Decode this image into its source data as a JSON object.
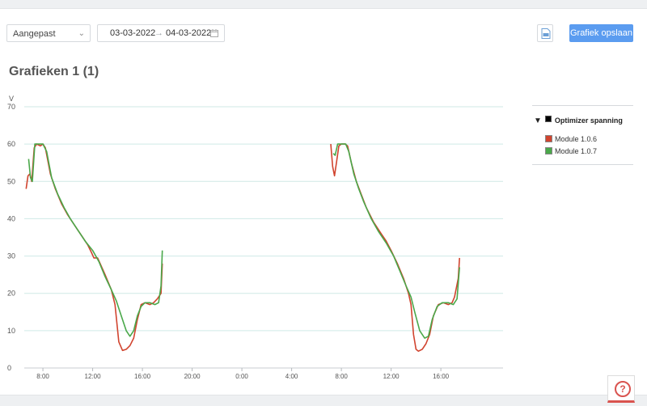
{
  "toolbar": {
    "period_select": "Aangepast",
    "date_from": "03-03-2022",
    "date_arrow": "→",
    "date_to": "04-03-2022",
    "save_label": "Grafiek opslaan"
  },
  "page_title": "Grafieken 1 (1)",
  "legend": {
    "group": "Optimizer spanning",
    "items": [
      {
        "label": "Module 1.0.6",
        "color": "#d1442f"
      },
      {
        "label": "Module 1.0.7",
        "color": "#4aa84a"
      }
    ]
  },
  "help_label": "?",
  "chart_data": {
    "type": "line",
    "ylabel": "V",
    "ylim": [
      0,
      70
    ],
    "yticks": [
      0,
      10,
      20,
      30,
      40,
      50,
      60,
      70
    ],
    "xlim": [
      6.5,
      45.0
    ],
    "xticks": [
      {
        "t": 8,
        "label": "8:00"
      },
      {
        "t": 12,
        "label": "12:00"
      },
      {
        "t": 16,
        "label": "16:00"
      },
      {
        "t": 20,
        "label": "20:00"
      },
      {
        "t": 24,
        "label": "0:00"
      },
      {
        "t": 28,
        "label": "4:00"
      },
      {
        "t": 32,
        "label": "8:00"
      },
      {
        "t": 36,
        "label": "12:00"
      },
      {
        "t": 40,
        "label": "16:00"
      }
    ],
    "series": [
      {
        "name": "Module 1.0.6",
        "color": "#d1442f",
        "segments": [
          [
            [
              6.65,
              48
            ],
            [
              6.8,
              51.5
            ],
            [
              6.95,
              52
            ],
            [
              7.1,
              50
            ],
            [
              7.3,
              59
            ],
            [
              7.5,
              60
            ],
            [
              7.8,
              59.5
            ],
            [
              8.0,
              60
            ],
            [
              8.2,
              59
            ],
            [
              8.6,
              52
            ],
            [
              9.0,
              48
            ],
            [
              9.5,
              44
            ],
            [
              10.0,
              41
            ],
            [
              10.6,
              38
            ],
            [
              11.2,
              35
            ],
            [
              11.6,
              33
            ],
            [
              11.9,
              31
            ],
            [
              12.1,
              29.5
            ],
            [
              12.4,
              29.5
            ],
            [
              12.6,
              28
            ],
            [
              13.0,
              25
            ],
            [
              13.5,
              21
            ],
            [
              13.8,
              17
            ],
            [
              14.1,
              7
            ],
            [
              14.4,
              4.7
            ],
            [
              14.7,
              5
            ],
            [
              15.0,
              6
            ],
            [
              15.3,
              8
            ],
            [
              15.6,
              13
            ],
            [
              15.9,
              17
            ],
            [
              16.2,
              17.5
            ],
            [
              16.6,
              17
            ],
            [
              16.9,
              17.5
            ],
            [
              17.2,
              18.5
            ],
            [
              17.5,
              20
            ],
            [
              17.6,
              28
            ]
          ],
          [
            [
              31.15,
              60
            ],
            [
              31.3,
              54
            ],
            [
              31.45,
              51.5
            ],
            [
              31.6,
              55
            ],
            [
              31.8,
              59.5
            ],
            [
              32.0,
              60
            ],
            [
              32.3,
              60
            ],
            [
              32.5,
              59.5
            ],
            [
              32.8,
              55
            ],
            [
              33.2,
              50
            ],
            [
              33.6,
              46.5
            ],
            [
              34.0,
              43
            ],
            [
              34.6,
              39
            ],
            [
              35.2,
              36
            ],
            [
              35.6,
              34
            ],
            [
              36.0,
              31.5
            ],
            [
              36.5,
              28
            ],
            [
              37.0,
              24
            ],
            [
              37.4,
              20
            ],
            [
              37.6,
              17
            ],
            [
              37.8,
              9
            ],
            [
              38.0,
              5
            ],
            [
              38.2,
              4.5
            ],
            [
              38.5,
              5
            ],
            [
              38.8,
              6.5
            ],
            [
              39.1,
              9
            ],
            [
              39.4,
              14
            ],
            [
              39.8,
              17
            ],
            [
              40.2,
              17.5
            ],
            [
              40.6,
              17
            ],
            [
              40.9,
              17.5
            ],
            [
              41.1,
              19
            ],
            [
              41.4,
              24
            ],
            [
              41.5,
              29.5
            ]
          ]
        ]
      },
      {
        "name": "Module 1.0.7",
        "color": "#4aa84a",
        "segments": [
          [
            [
              6.85,
              56
            ],
            [
              7.0,
              51
            ],
            [
              7.15,
              50
            ],
            [
              7.35,
              60
            ],
            [
              7.6,
              60
            ],
            [
              8.0,
              60
            ],
            [
              8.3,
              58
            ],
            [
              8.7,
              51
            ],
            [
              9.2,
              46.5
            ],
            [
              9.7,
              43
            ],
            [
              10.2,
              40
            ],
            [
              10.8,
              37
            ],
            [
              11.4,
              34
            ],
            [
              12.0,
              31.5
            ],
            [
              12.5,
              28.5
            ],
            [
              13.0,
              24.5
            ],
            [
              13.5,
              21
            ],
            [
              13.9,
              18
            ],
            [
              14.3,
              14
            ],
            [
              14.7,
              10
            ],
            [
              15.0,
              8.5
            ],
            [
              15.3,
              10
            ],
            [
              15.6,
              14
            ],
            [
              15.9,
              16.5
            ],
            [
              16.2,
              17.5
            ],
            [
              16.6,
              17.5
            ],
            [
              17.0,
              17
            ],
            [
              17.3,
              17.5
            ],
            [
              17.5,
              22
            ],
            [
              17.6,
              31.5
            ]
          ],
          [
            [
              31.35,
              57.5
            ],
            [
              31.5,
              57
            ],
            [
              31.7,
              60
            ],
            [
              32.0,
              60
            ],
            [
              32.35,
              60
            ],
            [
              32.6,
              58
            ],
            [
              33.0,
              52
            ],
            [
              33.4,
              48
            ],
            [
              33.8,
              44.5
            ],
            [
              34.4,
              40
            ],
            [
              35.0,
              36.5
            ],
            [
              35.6,
              33.5
            ],
            [
              36.2,
              30
            ],
            [
              36.7,
              26
            ],
            [
              37.2,
              22
            ],
            [
              37.6,
              19
            ],
            [
              37.9,
              15
            ],
            [
              38.3,
              10
            ],
            [
              38.7,
              8
            ],
            [
              39.0,
              8.5
            ],
            [
              39.3,
              13
            ],
            [
              39.7,
              16.5
            ],
            [
              40.1,
              17.5
            ],
            [
              40.6,
              17.5
            ],
            [
              41.0,
              17
            ],
            [
              41.3,
              18.5
            ],
            [
              41.5,
              27
            ]
          ]
        ]
      }
    ]
  }
}
